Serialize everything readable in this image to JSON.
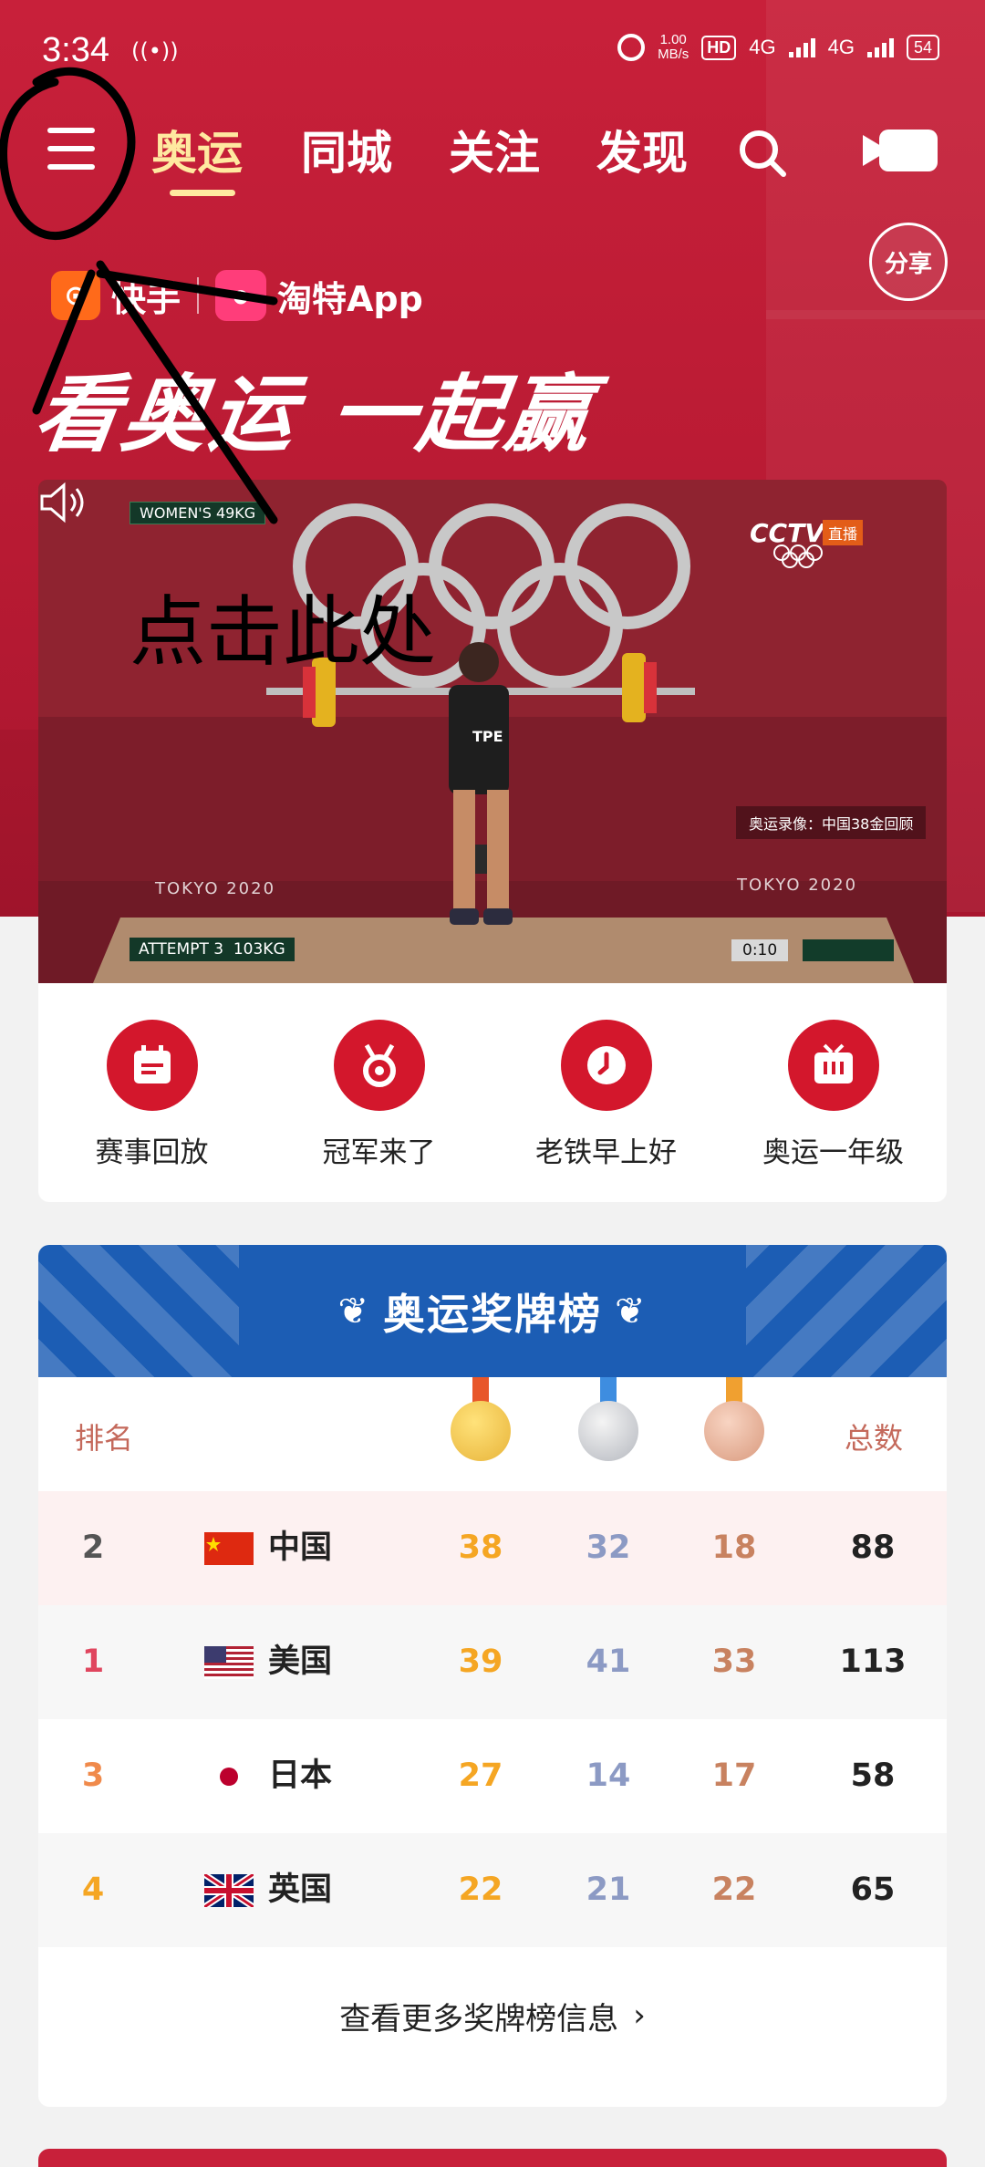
{
  "status_bar": {
    "time": "3:34",
    "speed_value": "1.00",
    "speed_unit": "MB/s",
    "hd": "HD",
    "network1": "4G",
    "network2": "4G",
    "battery": "54"
  },
  "nav": {
    "tabs": [
      {
        "label": "奥运",
        "active": true
      },
      {
        "label": "同城"
      },
      {
        "label": "关注"
      },
      {
        "label": "发现"
      }
    ]
  },
  "share_label": "分享",
  "sponsor": {
    "brand1": "快手",
    "brand2": "淘特App"
  },
  "slogan": "看奥运 一起赢",
  "video": {
    "event": "WOMEN'S 49KG",
    "attempt": "ATTEMPT 3",
    "weight": "103KG",
    "broadcaster": "CCTV",
    "live_badge": "直播",
    "caption": "奥运录像：中国38金回顾",
    "watermark": "TOKYO 2020",
    "time": "0:10",
    "bib": "TPE",
    "annotation": "点击此处"
  },
  "actions": [
    {
      "label": "赛事回放",
      "icon": "calendar-icon"
    },
    {
      "label": "冠军来了",
      "icon": "medal-icon"
    },
    {
      "label": "老铁早上好",
      "icon": "clock-icon"
    },
    {
      "label": "奥运一年级",
      "icon": "tv-icon"
    }
  ],
  "medal_table": {
    "title": "奥运奖牌榜",
    "header_rank": "排名",
    "header_total": "总数",
    "colors": {
      "gold": "#f5a623",
      "silver": "#8c9ac4",
      "bronze": "#c88260",
      "rank1": "#e0455e",
      "rank3": "#f08a4b",
      "rank4": "#f5a623"
    },
    "rows": [
      {
        "rank": "2",
        "country": "中国",
        "flag": "china",
        "gold": "38",
        "silver": "32",
        "bronze": "18",
        "total": "88"
      },
      {
        "rank": "1",
        "country": "美国",
        "flag": "usa",
        "gold": "39",
        "silver": "41",
        "bronze": "33",
        "total": "113"
      },
      {
        "rank": "3",
        "country": "日本",
        "flag": "japan",
        "gold": "27",
        "silver": "14",
        "bronze": "17",
        "total": "58"
      },
      {
        "rank": "4",
        "country": "英国",
        "flag": "uk",
        "gold": "22",
        "silver": "21",
        "bronze": "22",
        "total": "65"
      }
    ],
    "more_label": "查看更多奖牌榜信息"
  }
}
